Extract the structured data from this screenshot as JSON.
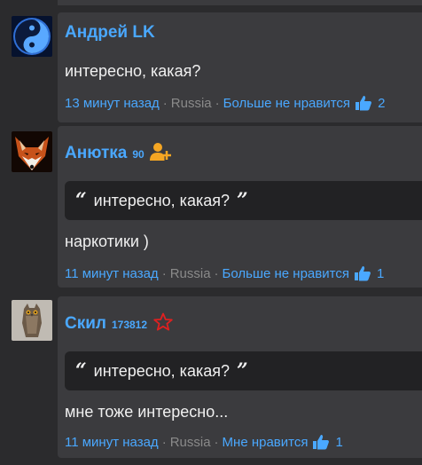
{
  "comments": [
    {
      "author": "Андрей LK",
      "score": "",
      "avatar_icon": "yin-yang-icon",
      "text": "интересно, какая?",
      "quote": "",
      "time": "13 минут назад",
      "country": "Russia",
      "like_label": "Больше не нравится",
      "likes": "2"
    },
    {
      "author": "Анютка",
      "score": "90",
      "badge_icon": "add-friend-icon",
      "avatar_icon": "fox-icon",
      "quote": "интересно, какая?",
      "text": "наркотики )",
      "time": "11 минут назад",
      "country": "Russia",
      "like_label": "Больше не нравится",
      "likes": "1"
    },
    {
      "author": "Скил",
      "score": "173812",
      "badge_icon": "star-outline-icon",
      "avatar_icon": "owl-icon",
      "quote": "интересно, какая?",
      "text": "мне тоже интересно...",
      "time": "11 минут назад",
      "country": "Russia",
      "like_label": "Мне нравится",
      "likes": "1"
    }
  ],
  "colors": {
    "background": "#2b2b2d",
    "card": "#3b3b3e",
    "quote_bg": "#222224",
    "link": "#4aa8ff",
    "muted": "#8a8a8a",
    "badge_orange": "#f5a623",
    "star_red": "#e02020"
  }
}
